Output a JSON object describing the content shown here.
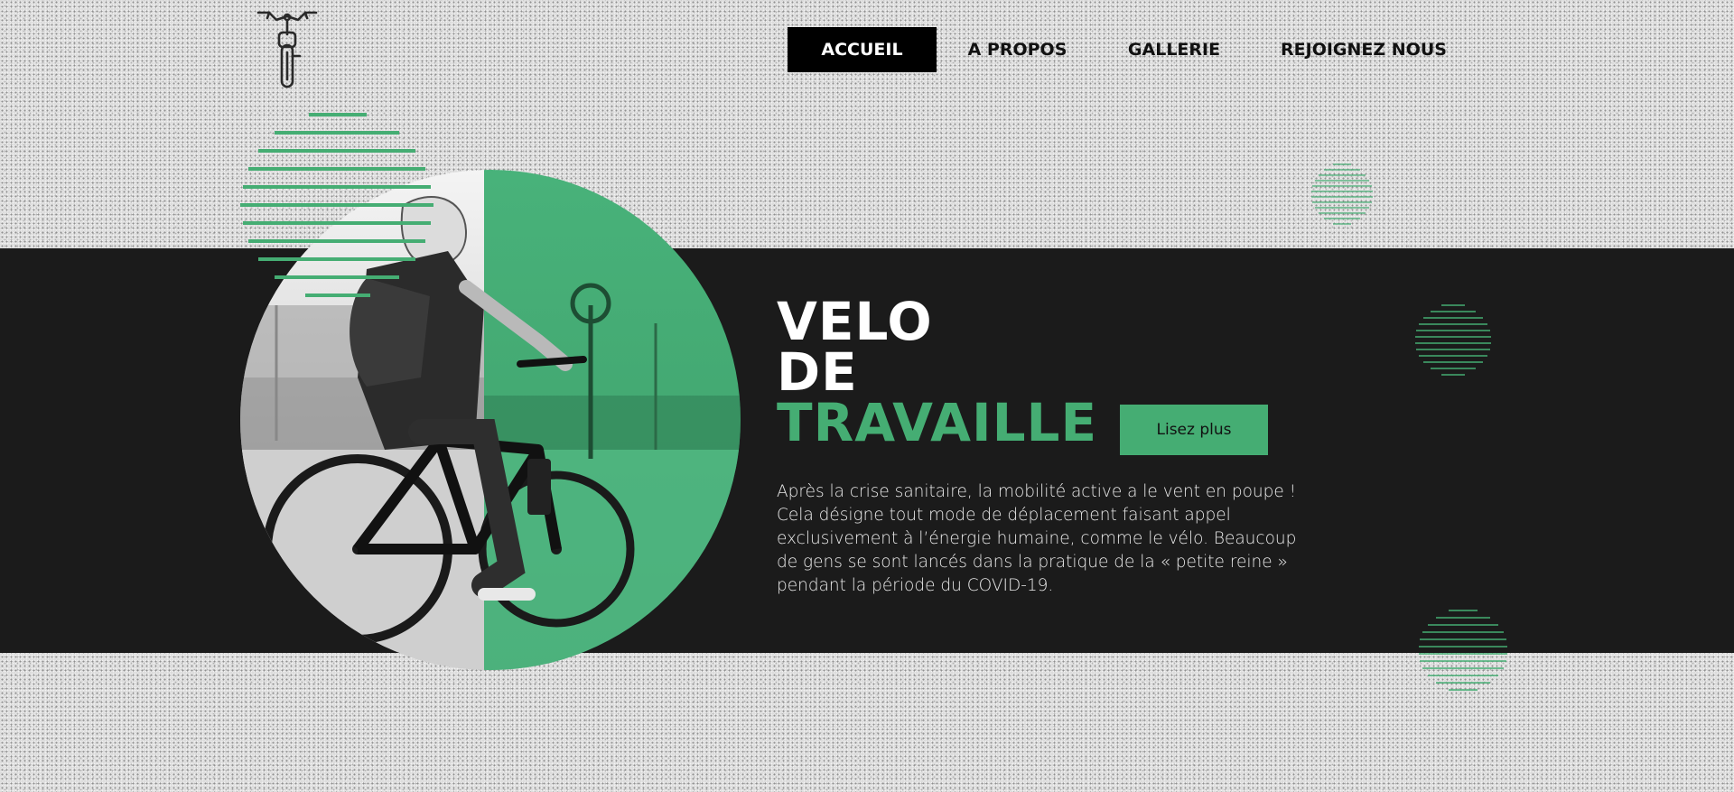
{
  "brand": {
    "logo_icon": "bicycle-icon"
  },
  "nav": {
    "items": [
      {
        "label": "ACCUEIL",
        "active": true
      },
      {
        "label": "A PROPOS",
        "active": false
      },
      {
        "label": "GALLERIE",
        "active": false
      },
      {
        "label": "REJOIGNEZ NOUS",
        "active": false
      }
    ]
  },
  "hero": {
    "title_line1": "VELO",
    "title_line2": "DE",
    "title_line3": "TRAVAILLE",
    "cta_label": "Lisez plus",
    "description": "Après la crise sanitaire, la mobilité active a le vent en poupe ! Cela désigne tout mode de déplacement faisant appel exclusivement à l’énergie humaine, comme le vélo. Beaucoup de gens se sont lancés dans la pratique de la « petite reine » pendant la période du COVID-19.",
    "image_icon": "cyclist-photo"
  },
  "colors": {
    "accent_green": "#45ad73",
    "dark_band": "#1b1b1b",
    "background": "#dcdcdc"
  }
}
